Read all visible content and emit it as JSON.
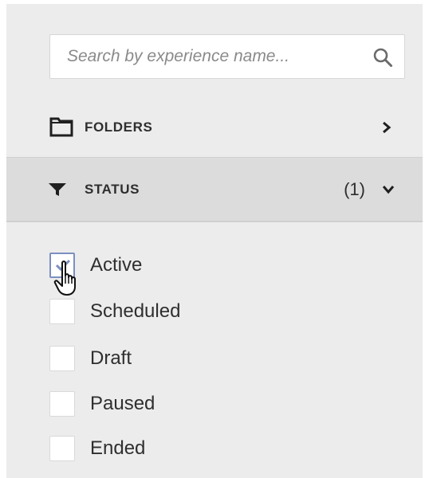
{
  "search": {
    "placeholder": "Search by experience name...",
    "value": "",
    "icon": "search-icon"
  },
  "folders": {
    "label": "FOLDERS",
    "icon": "folder-icon",
    "chevron": "chevron-right-icon"
  },
  "status": {
    "label": "STATUS",
    "count": "(1)",
    "icon": "filter-icon",
    "chevron": "chevron-down-icon",
    "options": [
      {
        "label": "Active",
        "checked": true
      },
      {
        "label": "Scheduled",
        "checked": false
      },
      {
        "label": "Draft",
        "checked": false
      },
      {
        "label": "Paused",
        "checked": false
      },
      {
        "label": "Ended",
        "checked": false
      }
    ]
  },
  "colors": {
    "panel_bg": "#ececec",
    "status_header_bg": "#dcdcdc",
    "checkbox_checked_border": "#7c8fc0",
    "text": "#2e2e2e"
  }
}
